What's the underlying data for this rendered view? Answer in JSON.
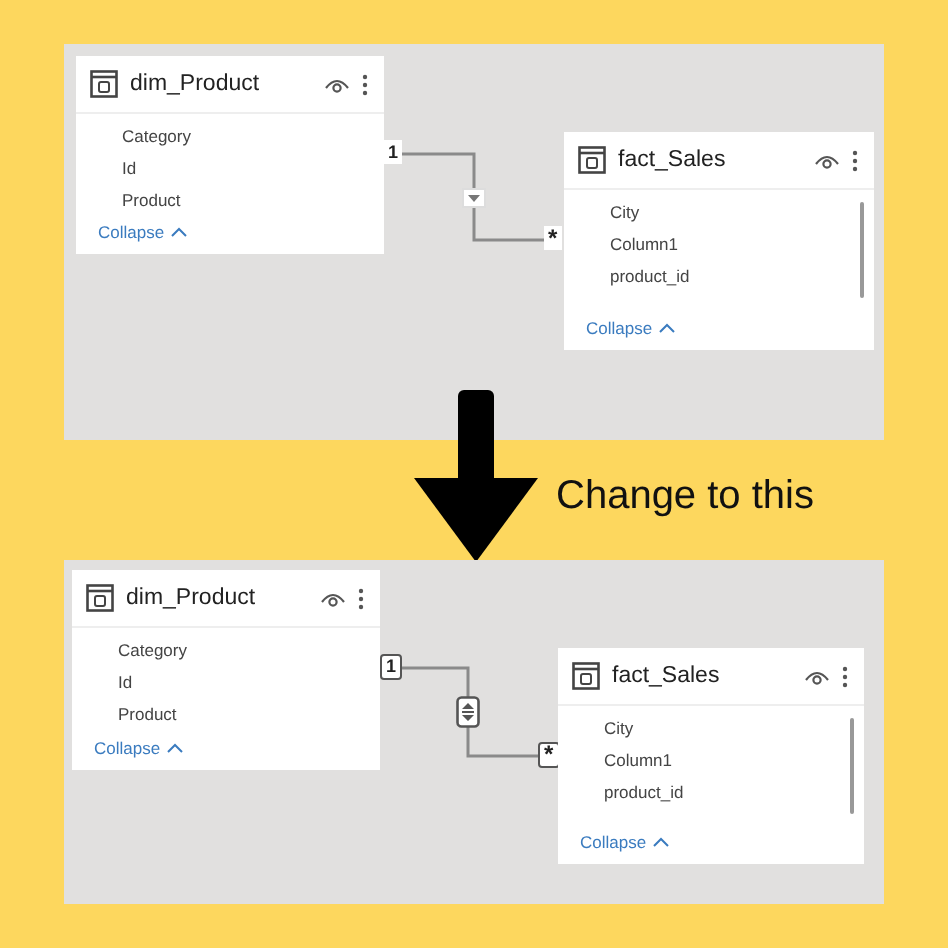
{
  "diagrams": [
    {
      "tables": [
        {
          "name": "dim_Product",
          "columns": [
            "Category",
            "Id",
            "Product"
          ],
          "collapse": "Collapse"
        },
        {
          "name": "fact_Sales",
          "columns": [
            "City",
            "Column1",
            "product_id"
          ],
          "collapse": "Collapse"
        }
      ],
      "relationship": {
        "from_label": "1",
        "to_label": "*",
        "kind": "single"
      }
    },
    {
      "tables": [
        {
          "name": "dim_Product",
          "columns": [
            "Category",
            "Id",
            "Product"
          ],
          "collapse": "Collapse"
        },
        {
          "name": "fact_Sales",
          "columns": [
            "City",
            "Column1",
            "product_id"
          ],
          "collapse": "Collapse"
        }
      ],
      "relationship": {
        "from_label": "1",
        "to_label": "*",
        "kind": "both"
      }
    }
  ],
  "caption": "Change to this"
}
